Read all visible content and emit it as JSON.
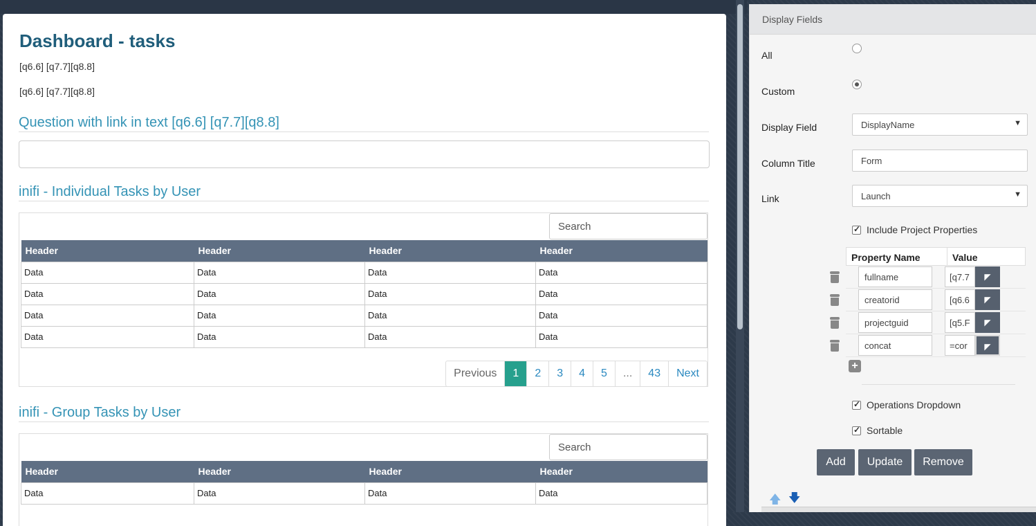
{
  "main": {
    "title": "Dashboard - tasks",
    "q_line_1": "[q6.6] [q7.7][q8.8]",
    "q_line_2": "[q6.6] [q7.7][q8.8]",
    "question_title": "Question with link in text [q6.6] [q7.7][q8.8]",
    "section1": {
      "title": "inifi - Individual Tasks by User",
      "search_placeholder": "Search",
      "headers": [
        "Header",
        "Header",
        "Header",
        "Header"
      ],
      "rows": [
        [
          "Data",
          "Data",
          "Data",
          "Data"
        ],
        [
          "Data",
          "Data",
          "Data",
          "Data"
        ],
        [
          "Data",
          "Data",
          "Data",
          "Data"
        ],
        [
          "Data",
          "Data",
          "Data",
          "Data"
        ]
      ],
      "pager": {
        "previous": "Previous",
        "pages": [
          "1",
          "2",
          "3",
          "4",
          "5",
          "...",
          "43"
        ],
        "next": "Next",
        "active_page": "1"
      }
    },
    "section2": {
      "title": "inifi - Group Tasks by User",
      "search_placeholder": "Search",
      "headers": [
        "Header",
        "Header",
        "Header",
        "Header"
      ],
      "rows": [
        [
          "Data",
          "Data",
          "Data",
          "Data"
        ]
      ]
    }
  },
  "panel": {
    "header": "Display Fields",
    "all_label": "All",
    "custom_label": "Custom",
    "display_field_label": "Display Field",
    "display_field_value": "DisplayName",
    "column_title_label": "Column Title",
    "column_title_value": "Form",
    "link_label": "Link",
    "link_value": "Launch",
    "include_project_properties": "Include Project Properties",
    "prop_headers": {
      "name": "Property Name",
      "value": "Value"
    },
    "properties": [
      {
        "name": "fullname",
        "value": "[q7.7"
      },
      {
        "name": "creatorid",
        "value": "[q6.6"
      },
      {
        "name": "projectguid",
        "value": "[q5.F"
      },
      {
        "name": "concat",
        "value": "=cor"
      }
    ],
    "operations_dropdown": "Operations Dropdown",
    "sortable": "Sortable",
    "buttons": {
      "add": "Add",
      "update": "Update",
      "remove": "Remove"
    }
  }
}
